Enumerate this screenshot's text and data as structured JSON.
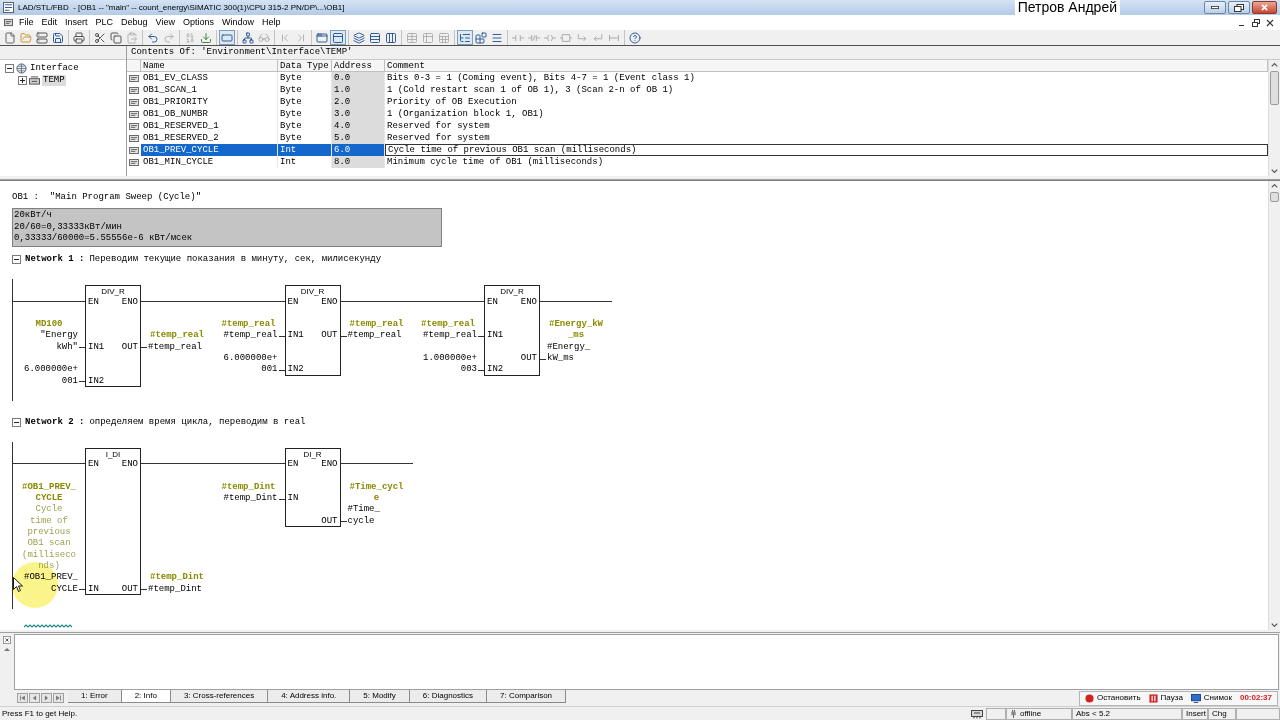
{
  "window": {
    "title": "LAD/STL/FBD  - [OB1 -- \"main\" -- count_energy\\SIMATIC 300(1)\\CPU 315-2 PN/DP\\...\\OB1]",
    "user_label": "Петров Андрей"
  },
  "menu": [
    "File",
    "Edit",
    "Insert",
    "PLC",
    "Debug",
    "View",
    "Options",
    "Window",
    "Help"
  ],
  "toolbar": [
    [
      {
        "disabled": false,
        "pressed": false
      },
      {
        "disabled": false,
        "pressed": false
      },
      {
        "disabled": false,
        "pressed": false
      },
      {
        "disabled": false,
        "pressed": false
      }
    ],
    [
      {
        "disabled": false,
        "pressed": false
      }
    ],
    [
      {
        "disabled": false,
        "pressed": false
      },
      {
        "disabled": false,
        "pressed": false
      },
      {
        "disabled": true,
        "pressed": false
      }
    ],
    [
      {
        "disabled": false,
        "pressed": false
      },
      {
        "disabled": true,
        "pressed": false
      }
    ],
    [
      {
        "disabled": true,
        "pressed": false
      },
      {
        "disabled": false,
        "pressed": false
      }
    ],
    [
      {
        "disabled": false,
        "pressed": true
      }
    ],
    [
      {
        "disabled": false,
        "pressed": false
      },
      {
        "disabled": true,
        "pressed": false
      }
    ],
    [
      {
        "disabled": true,
        "pressed": false
      },
      {
        "disabled": true,
        "pressed": false
      }
    ],
    [
      {
        "disabled": false,
        "pressed": false
      },
      {
        "disabled": false,
        "pressed": true
      }
    ],
    [
      {
        "disabled": false,
        "pressed": false
      },
      {
        "disabled": false,
        "pressed": false
      },
      {
        "disabled": false,
        "pressed": false
      }
    ],
    [
      {
        "disabled": true,
        "pressed": false
      },
      {
        "disabled": true,
        "pressed": false
      },
      {
        "disabled": true,
        "pressed": false
      }
    ],
    [
      {
        "disabled": false,
        "pressed": true
      },
      {
        "disabled": false,
        "pressed": false
      },
      {
        "disabled": false,
        "pressed": false
      }
    ],
    [
      {
        "disabled": true,
        "pressed": false
      },
      {
        "disabled": true,
        "pressed": false
      },
      {
        "disabled": true,
        "pressed": false
      },
      {
        "disabled": true,
        "pressed": false
      },
      {
        "disabled": true,
        "pressed": false
      },
      {
        "disabled": true,
        "pressed": false
      },
      {
        "disabled": true,
        "pressed": false
      }
    ],
    [
      {
        "disabled": false,
        "pressed": false
      }
    ]
  ],
  "interface": {
    "tree": [
      {
        "label": "Interface",
        "expanded": true,
        "selected": false,
        "children": [
          {
            "label": "TEMP",
            "expanded": false,
            "selected": true
          }
        ]
      }
    ],
    "contents_title": "Contents Of: 'Environment\\Interface\\TEMP'",
    "columns": [
      "Name",
      "Data Type",
      "Address",
      "Comment"
    ],
    "rows": [
      {
        "name": "OB1_EV_CLASS",
        "data_type": "Byte",
        "address": "0.0",
        "comment": "Bits 0-3 = 1 (Coming event), Bits 4-7 = 1 (Event class 1)",
        "selected": false
      },
      {
        "name": "OB1_SCAN_1",
        "data_type": "Byte",
        "address": "1.0",
        "comment": "1 (Cold restart scan 1 of OB 1), 3 (Scan 2-n of OB 1)",
        "selected": false
      },
      {
        "name": "OB1_PRIORITY",
        "data_type": "Byte",
        "address": "2.0",
        "comment": "Priority of OB Execution",
        "selected": false
      },
      {
        "name": "OB1_OB_NUMBR",
        "data_type": "Byte",
        "address": "3.0",
        "comment": "1 (Organization block 1, OB1)",
        "selected": false
      },
      {
        "name": "OB1_RESERVED_1",
        "data_type": "Byte",
        "address": "4.0",
        "comment": "Reserved for system",
        "selected": false
      },
      {
        "name": "OB1_RESERVED_2",
        "data_type": "Byte",
        "address": "5.0",
        "comment": "Reserved for system",
        "selected": false
      },
      {
        "name": "OB1_PREV_CYCLE",
        "data_type": "Int",
        "address": "6.0",
        "comment": "Cycle time of previous OB1 scan (milliseconds)",
        "selected": true
      },
      {
        "name": "OB1_MIN_CYCLE",
        "data_type": "Int",
        "address": "8.0",
        "comment": "Minimum cycle time of OB1 (milliseconds)",
        "selected": false
      }
    ]
  },
  "editor": {
    "block_title": "OB1 :  \"Main Program Sweep (Cycle)\"",
    "block_comment": "20кВт/ч\n20/60=0,33333кВт/мин\n0,33333/60000=5.55556e-6 кВт/мсек",
    "networks": [
      {
        "title": "Network 1 :",
        "comment": "Переводим текущие показания в минуту, сек, милисекунду",
        "expanded": true,
        "boxes": [
          {
            "name": "DIV_R",
            "en": "EN",
            "eno": "ENO",
            "inputs": [
              {
                "pin": "IN1",
                "info": "MD100",
                "operand": "\"Energy\nkWh\""
              },
              {
                "pin": "IN2",
                "operand": "6.000000e+\n001"
              }
            ],
            "outputs": [
              {
                "pin": "OUT",
                "info": "#temp_real",
                "operand": "#temp_real"
              }
            ]
          },
          {
            "name": "DIV_R",
            "en": "EN",
            "eno": "ENO",
            "inputs": [
              {
                "pin": "IN1",
                "info": "#temp_real",
                "operand": "#temp_real"
              },
              {
                "pin": "IN2",
                "operand": "6.000000e+\n001"
              }
            ],
            "outputs": [
              {
                "pin": "OUT",
                "info": "#temp_real",
                "operand": "#temp_real"
              }
            ]
          },
          {
            "name": "DIV_R",
            "en": "EN",
            "eno": "ENO",
            "inputs": [
              {
                "pin": "IN1",
                "info": "#temp_real",
                "operand": "#temp_real"
              },
              {
                "pin": "IN2",
                "operand": "1.000000e+\n003"
              }
            ],
            "outputs": [
              {
                "pin": "OUT",
                "info": "#Energy_kW\n_ms",
                "operand": "#Energy_\nkW_ms"
              }
            ]
          }
        ]
      },
      {
        "title": "Network 2 :",
        "comment": "определяем время цикла, переводим в real",
        "expanded": true,
        "boxes": [
          {
            "name": "I_DI",
            "en": "EN",
            "eno": "ENO",
            "inputs": [
              {
                "pin": "IN",
                "info": "#OB1_PREV_\nCYCLE",
                "info_comment": "Cycle\ntime of\nprevious\nOB1 scan\n(milliseco\nnds)",
                "operand": "#OB1_PREV_\nCYCLE"
              }
            ],
            "outputs": [
              {
                "pin": "OUT",
                "info": "#temp_Dint",
                "operand": "#temp_Dint"
              }
            ]
          },
          {
            "name": "DI_R",
            "en": "EN",
            "eno": "ENO",
            "inputs": [
              {
                "pin": "IN",
                "info": "#temp_Dint",
                "operand": "#temp_Dint"
              }
            ],
            "outputs": [
              {
                "pin": "OUT",
                "info": "#Time_cycl\ne",
                "operand": "#Time_\ncycle"
              }
            ]
          }
        ]
      }
    ]
  },
  "output": {
    "tabs": [
      {
        "label": "1: Error",
        "selected": false
      },
      {
        "label": "2: Info",
        "selected": true
      },
      {
        "label": "3: Cross-references",
        "selected": false
      },
      {
        "label": "4: Address info.",
        "selected": false
      },
      {
        "label": "5: Modify",
        "selected": false
      },
      {
        "label": "6: Diagnostics",
        "selected": false
      },
      {
        "label": "7: Comparison",
        "selected": false
      }
    ]
  },
  "recorder": {
    "buttons": [
      {
        "kind": "stop",
        "label": "Остановить"
      },
      {
        "kind": "pause",
        "label": "Пауза"
      },
      {
        "kind": "snapshot",
        "label": "Снимок"
      }
    ],
    "elapsed": "00:02:37"
  },
  "status_bar": {
    "help": "Press F1 to get Help.",
    "panels": [
      "offline",
      "Abs < 5.2",
      "Insert",
      "Chg"
    ]
  }
}
